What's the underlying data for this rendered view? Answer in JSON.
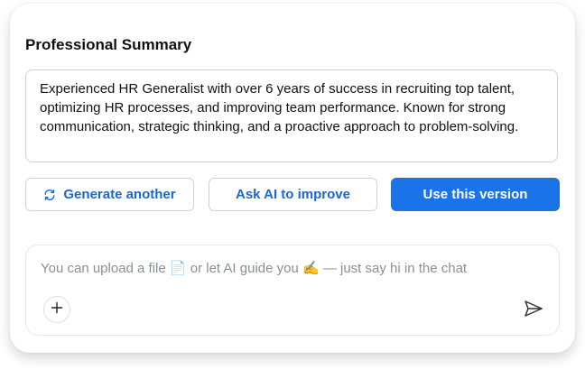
{
  "summary": {
    "title": "Professional Summary",
    "text": "Experienced HR Generalist with over 6 years of success in recruiting top talent, optimizing HR processes, and improving team performance. Known for strong communication, strategic thinking, and a proactive approach to problem-solving."
  },
  "actions": {
    "generate_label": "Generate another",
    "generate_icon": "refresh-icon",
    "improve_label": "Ask AI to improve",
    "use_label": "Use this version"
  },
  "chat": {
    "placeholder": "You can upload a file 📄 or let AI guide you ✍️ — just say hi in the chat",
    "add_icon": "plus-icon",
    "send_icon": "send-icon"
  },
  "colors": {
    "accent": "#1a73e8",
    "accent_text": "#1a66d8",
    "border": "#cfd3d9",
    "placeholder": "#8a8f96"
  }
}
